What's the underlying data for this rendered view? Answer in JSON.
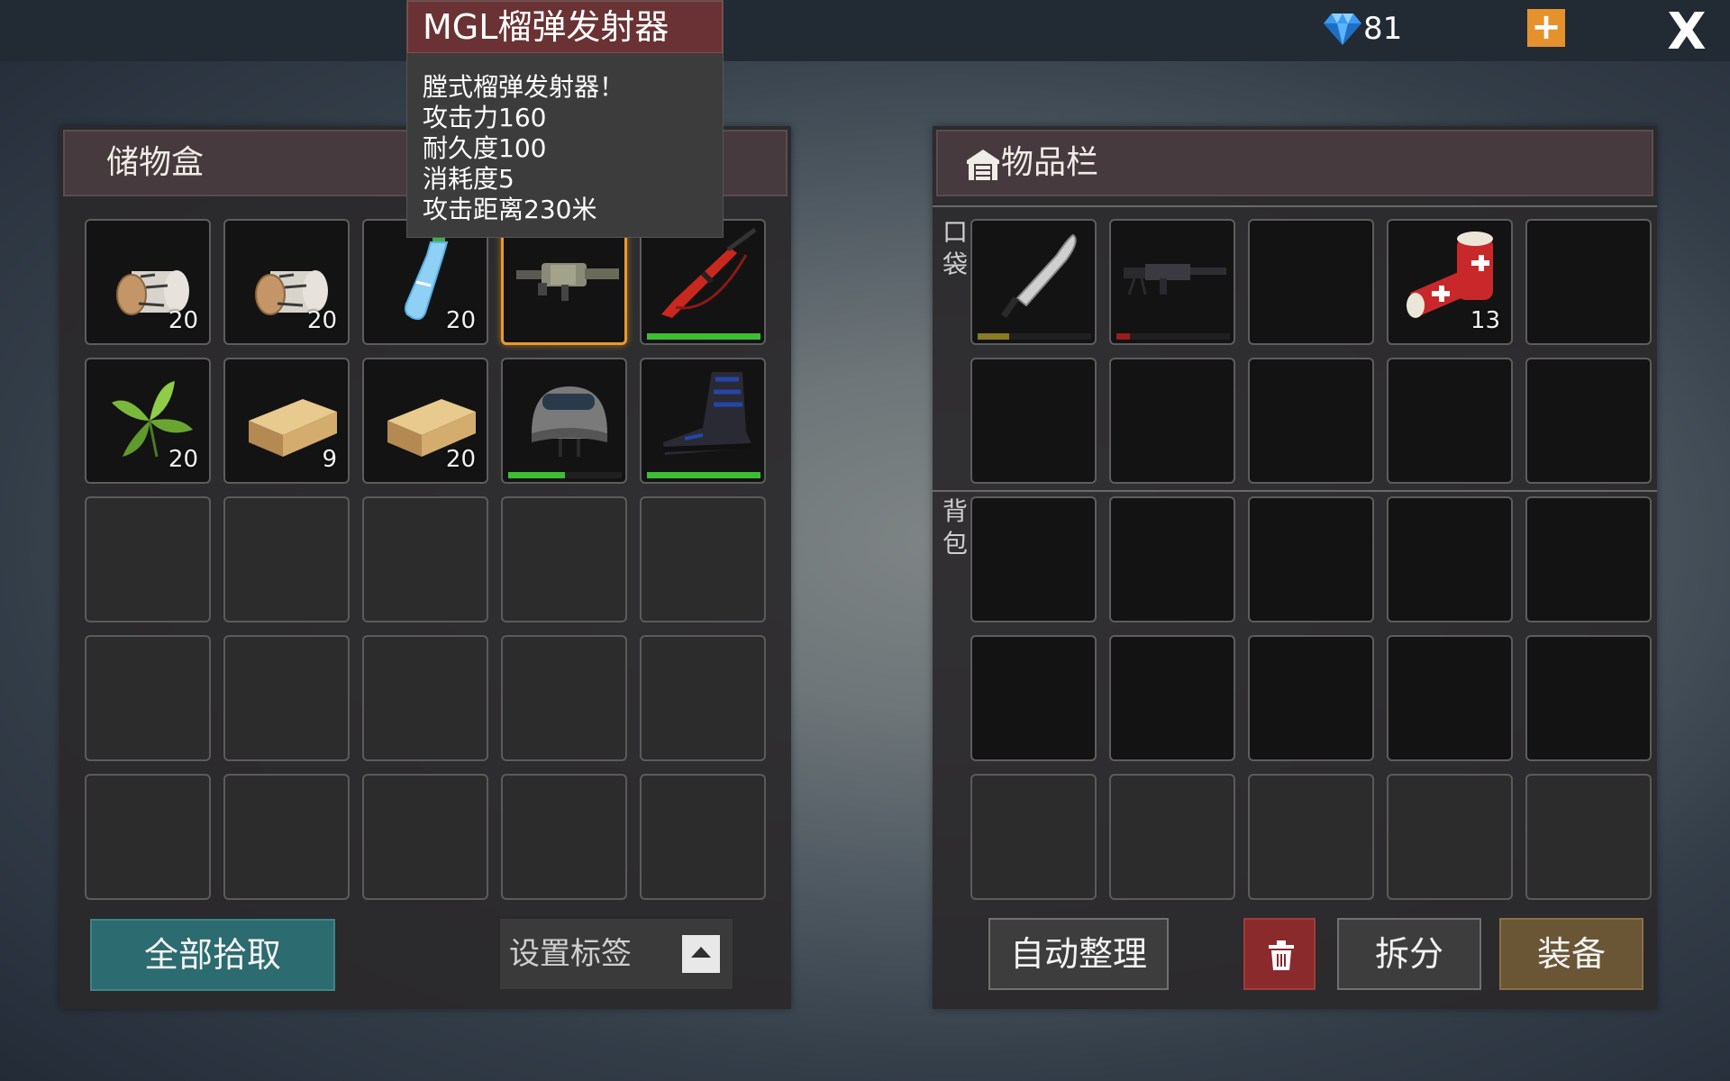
{
  "topbar": {
    "gem_icon": "diamond-icon",
    "gem_count": "81",
    "plus_label": "+",
    "close_label": "X"
  },
  "storage": {
    "title": "储物盒",
    "items": [
      {
        "icon": "log-icon",
        "qty": "20"
      },
      {
        "icon": "log-icon",
        "qty": "20"
      },
      {
        "icon": "water-bottle-icon",
        "qty": "20"
      },
      {
        "icon": "grenade-launcher-icon",
        "qty": "",
        "selected": true
      },
      {
        "icon": "rifle-icon",
        "qty": "",
        "durability": 1.0
      },
      {
        "icon": "herb-icon",
        "qty": "20"
      },
      {
        "icon": "wood-plank-icon",
        "qty": "9"
      },
      {
        "icon": "wood-plank-icon",
        "qty": "20"
      },
      {
        "icon": "helmet-icon",
        "qty": "",
        "durability": 0.5
      },
      {
        "icon": "boot-icon",
        "qty": "",
        "durability": 1.0
      }
    ],
    "pickall_label": "全部拾取",
    "tag_label": "设置标签"
  },
  "inventory": {
    "title": "物品栏",
    "pocket_label_1": "口",
    "pocket_label_2": "袋",
    "backpack_label_1": "背",
    "backpack_label_2": "包",
    "pocket_items": [
      {
        "icon": "machete-icon",
        "qty": "",
        "durability": 0.28,
        "bar_color": "#8a7a22"
      },
      {
        "icon": "machine-gun-icon",
        "qty": "",
        "durability": 0.12,
        "bar_color": "#9a1c1c"
      },
      {
        "icon": "",
        "qty": ""
      },
      {
        "icon": "bandage-icon",
        "qty": "13"
      },
      {
        "icon": "",
        "qty": ""
      }
    ],
    "auto_label": "自动整理",
    "split_label": "拆分",
    "equip_label": "装备"
  },
  "tooltip": {
    "title": "MGL榴弹发射器",
    "lines": [
      "膛式榴弹发射器！",
      "攻击力160",
      "耐久度100",
      "消耗度5",
      "攻击距离230米"
    ]
  },
  "colors": {
    "accent": "#e5922c",
    "selected_border": "#e99a2a",
    "pickall": "#2c6b70",
    "trash": "#8a2a2c",
    "equip": "#6a5535",
    "durability_good": "#3cbf32"
  }
}
